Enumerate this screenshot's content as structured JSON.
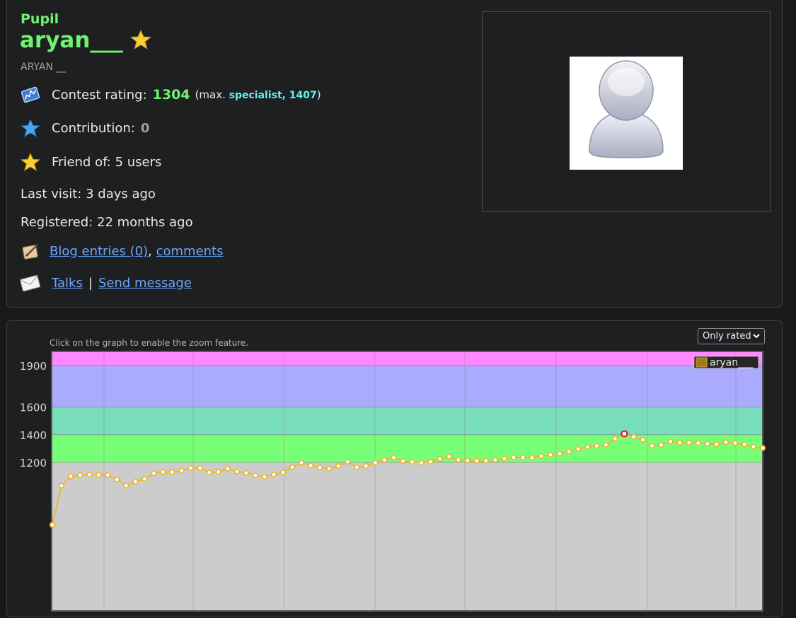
{
  "profile": {
    "rank": "Pupil",
    "handle": "aryan___",
    "full_name": "ARYAN __",
    "contest_rating_label": "Contest rating:",
    "contest_rating": "1304",
    "max_open": "(max.",
    "max_rank": "specialist,",
    "max_rating": "1407",
    "max_close": ")",
    "contribution_label": "Contribution:",
    "contribution": "0",
    "friend_of": "Friend of: 5 users",
    "last_visit": "Last visit: 3 days ago",
    "registered": "Registered: 22 months ago",
    "blog_entries": "Blog entries (0)",
    "blog_sep": ",",
    "comments": "comments",
    "talks": "Talks",
    "talks_sep": "|",
    "send_message": "Send message"
  },
  "graph": {
    "hint": "Click on the graph to enable the zoom feature.",
    "filter": {
      "selected": "Only rated"
    }
  },
  "colors": {
    "pupil": "#6ff36f",
    "specialist": "#60f0f0",
    "link": "#6aa6ff",
    "line": "#e8b93a",
    "max_marker": "#e01515"
  },
  "icons": [
    "rating-icon",
    "contribution-star-icon",
    "friend-star-icon",
    "blog-icon",
    "message-envelope-icon",
    "avatar-placeholder-icon",
    "chevron-down-icon",
    "handle-star-icon"
  ],
  "chart_data": {
    "type": "line",
    "xlabel": "",
    "ylabel": "",
    "yticks": [
      1200,
      1400,
      1600,
      1900
    ],
    "ylim": [
      730,
      1960
    ],
    "grid": true,
    "legend": "top-right",
    "bands": [
      {
        "from": 0,
        "to": 1200,
        "color": "#cccccc"
      },
      {
        "from": 1200,
        "to": 1400,
        "color": "#77ff77"
      },
      {
        "from": 1400,
        "to": 1600,
        "color": "#77ddbb"
      },
      {
        "from": 1600,
        "to": 1900,
        "color": "#aaaaff"
      },
      {
        "from": 1900,
        "to": 2100,
        "color": "#ff88ff"
      }
    ],
    "series": [
      {
        "name": "aryan___",
        "color": "#e8b93a",
        "values": [
          750,
          1032,
          1100,
          1109,
          1112,
          1111,
          1109,
          1078,
          1033,
          1062,
          1081,
          1121,
          1131,
          1130,
          1141,
          1160,
          1158,
          1127,
          1132,
          1155,
          1135,
          1125,
          1106,
          1096,
          1113,
          1128,
          1166,
          1198,
          1178,
          1164,
          1155,
          1175,
          1205,
          1165,
          1175,
          1198,
          1218,
          1236,
          1210,
          1204,
          1198,
          1205,
          1226,
          1241,
          1219,
          1214,
          1213,
          1213,
          1219,
          1227,
          1236,
          1236,
          1233,
          1246,
          1254,
          1264,
          1278,
          1298,
          1311,
          1319,
          1327,
          1372,
          1407,
          1384,
          1363,
          1320,
          1326,
          1350,
          1343,
          1342,
          1340,
          1335,
          1331,
          1346,
          1340,
          1330,
          1313,
          1304
        ]
      }
    ],
    "max_point": {
      "rating": 1407,
      "rank": "specialist"
    }
  }
}
